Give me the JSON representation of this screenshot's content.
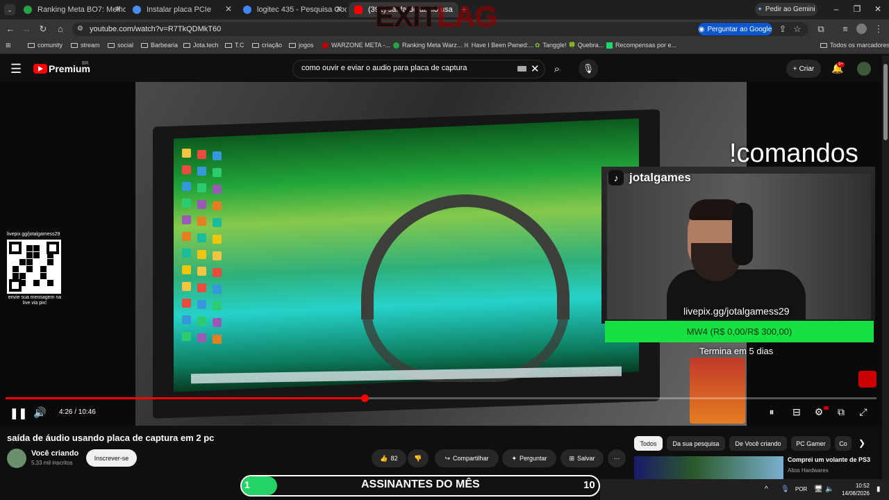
{
  "browser": {
    "tabs": [
      {
        "title": "Ranking Meta BO7: Melhores C",
        "color": "#25a244"
      },
      {
        "title": "Instalar placa PCIe",
        "color": "#4b8bf5"
      },
      {
        "title": "logitec 435 - Pesquisa Google",
        "color": "#4285f4"
      },
      {
        "title": "(391) saída de áudio usa",
        "color": "#ff0000"
      }
    ],
    "new_tab": "+",
    "gemini_button": "Pedir ao Gemini",
    "url": "youtube.com/watch?v=R7TkQDMkT60",
    "ask_google": "Perguntar ao Google",
    "bookmarks": [
      "comunity",
      "stream",
      "social",
      "Barbearia",
      "Jota.tech",
      "T.C",
      "criação",
      "jogos",
      "WARZONE META -...",
      "Ranking Meta Warz...",
      "Have I Been Pwned:...",
      "Tanggle! 🍀 Quebra...",
      "Recompensas por e..."
    ],
    "all_bookmarks": "Todos os marcadores"
  },
  "youtube": {
    "premium_label": "Premium",
    "region": "BR",
    "search_query": "como ouvir e eviar o audio para placa de captura",
    "create_label": "Criar",
    "notif_badge": "9+"
  },
  "video": {
    "overlay_comandos": "!comandos",
    "tiktok_name": "jotalgames",
    "livepix_url": "livepix.gg/jotalgamess29",
    "goal_text": "MW4 (R$ 0,00/R$ 300,00)",
    "goal_progress": 0,
    "ends_text": "Termina em 5 dias",
    "qr_top": "livepix.gg/jotalgamess29",
    "qr_bottom": "envie sua mensagem na live via pix!",
    "time_current": "4:26",
    "time_total": "10:46",
    "time_display": "4:26 / 10:46",
    "progress": 0.412
  },
  "details": {
    "title": "saída de áudio usando placa de captura em 2 pc",
    "channel": "Você criando",
    "subscribers": "5,33 mil inscritos",
    "subscribe": "Inscrever-se",
    "likes": "82",
    "share": "Compartilhar",
    "ask": "Perguntar",
    "save": "Salvar"
  },
  "chips": [
    "Todos",
    "Da sua pesquisa",
    "De Você criando",
    "PC Gamer",
    "Co"
  ],
  "recommendation": {
    "title": "Comprei um volante de PS3",
    "channel": "Altos Hardwares"
  },
  "overlays": {
    "exitlag_a": "EXIT",
    "exitlag_b": "LAG",
    "sub_count_left": "1",
    "sub_label": "ASSINANTES DO MÊS",
    "sub_count_right": "10"
  },
  "taskbar": {
    "lang": "POR",
    "time": "10:52",
    "date": "14/08/2026"
  },
  "colors": {
    "accent_red": "#ff0000",
    "goal_green": "#17e043",
    "ask_google_blue": "#0b57d0"
  }
}
